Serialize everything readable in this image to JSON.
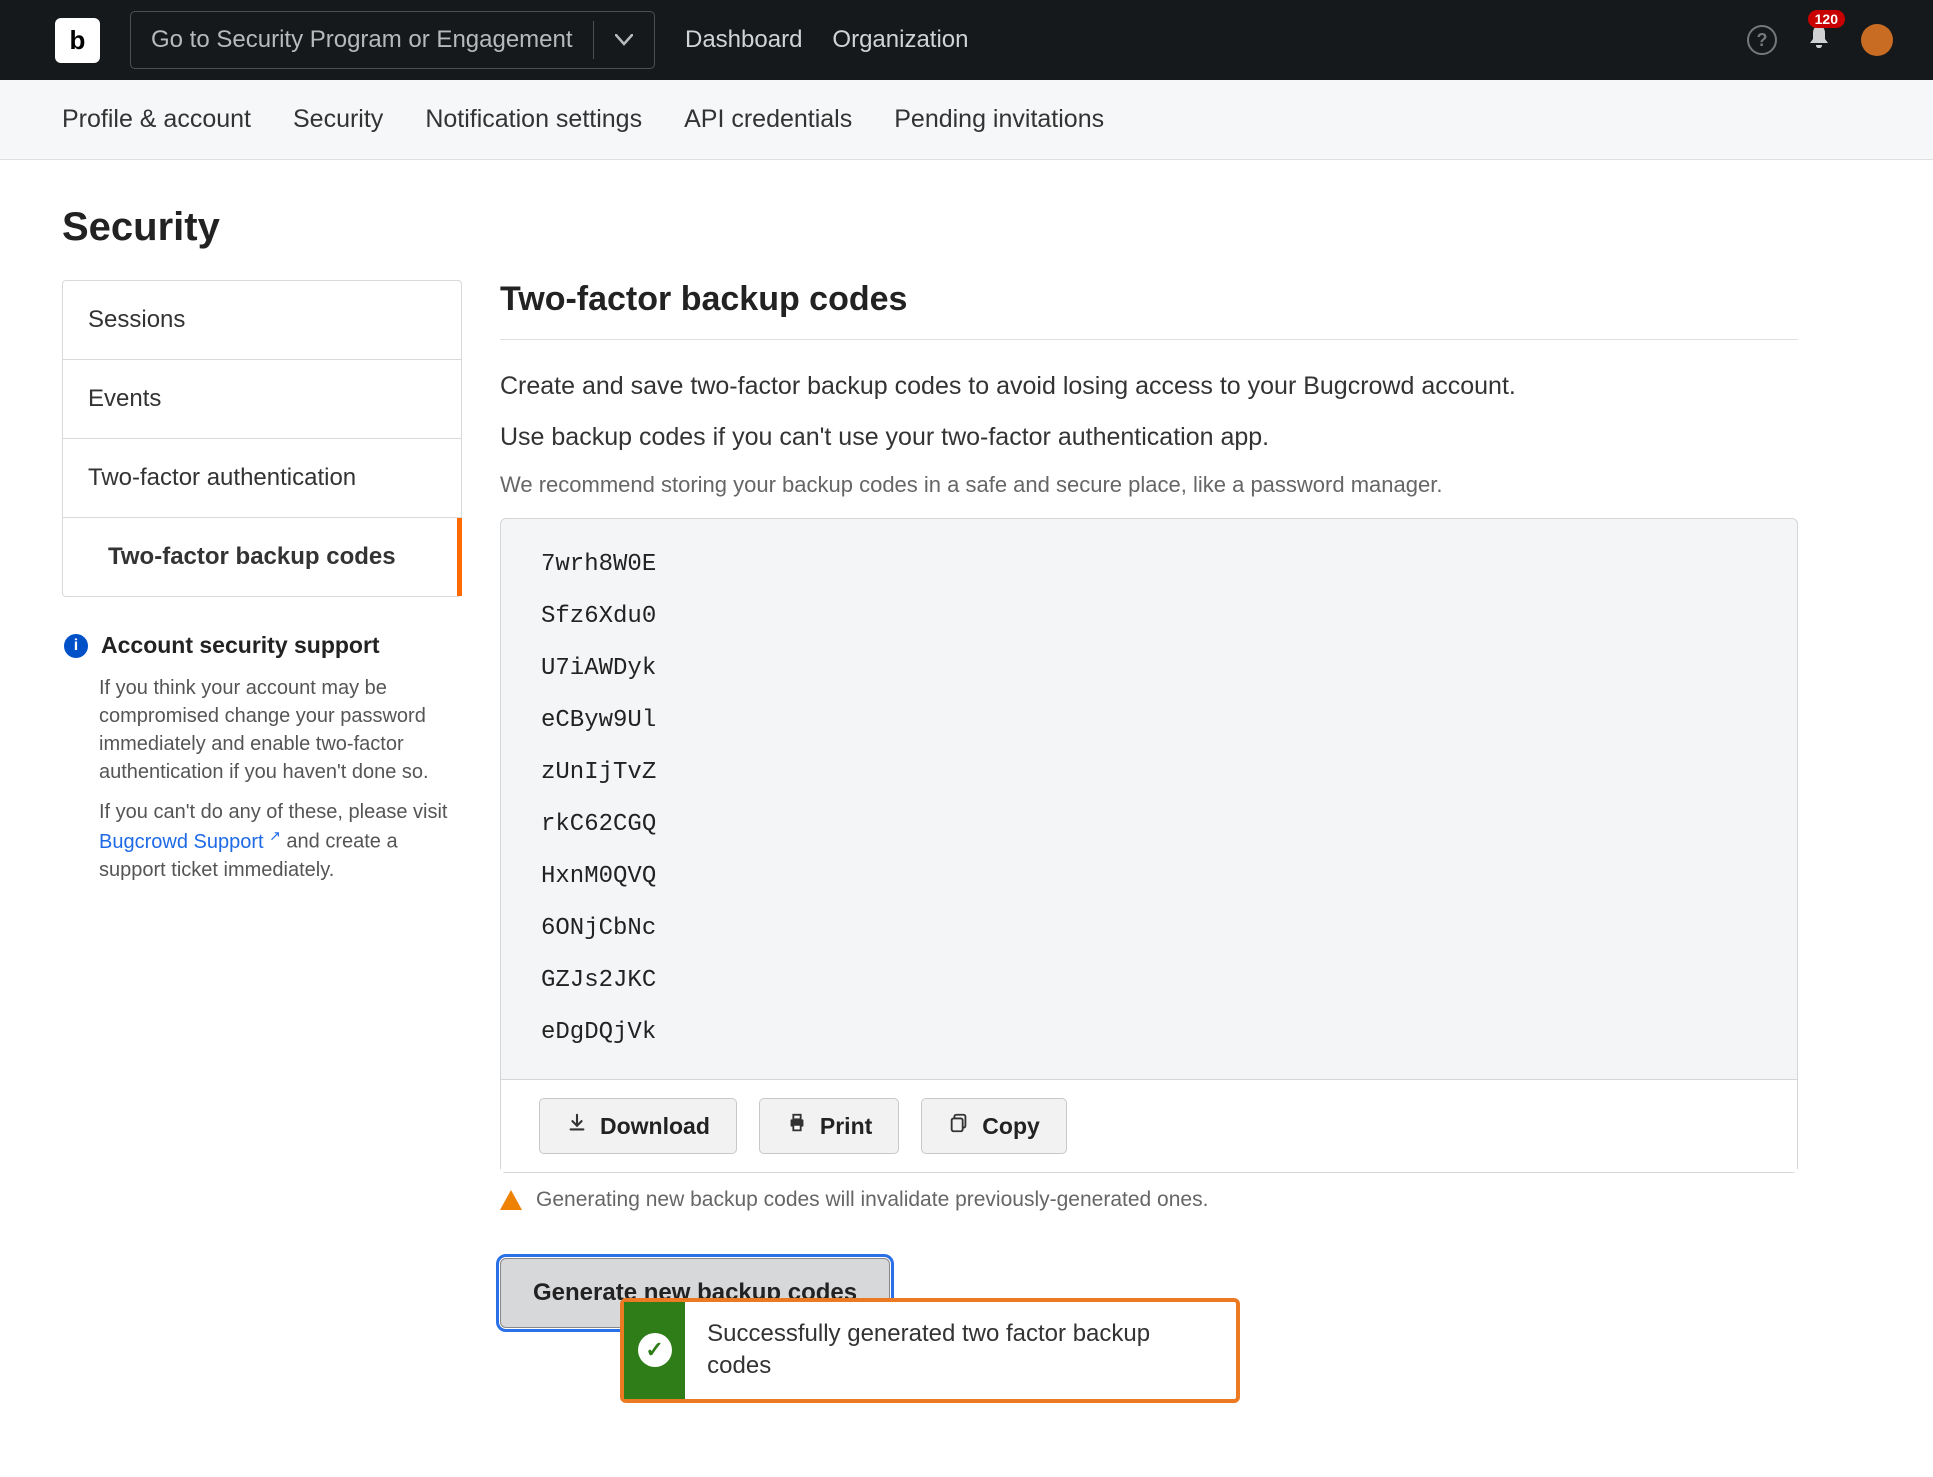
{
  "topnav": {
    "logo_letter": "b",
    "program_selector_placeholder": "Go to Security Program or Engagement",
    "links": {
      "dashboard": "Dashboard",
      "organization": "Organization"
    },
    "help_glyph": "?",
    "notifications_count": "120"
  },
  "subnav": {
    "tabs": {
      "profile": "Profile & account",
      "security": "Security",
      "notifications": "Notification settings",
      "api": "API credentials",
      "pending": "Pending invitations"
    }
  },
  "page": {
    "title": "Security"
  },
  "sidebar": {
    "items": {
      "sessions": "Sessions",
      "events": "Events",
      "twofactor": "Two-factor authentication",
      "backup": "Two-factor backup codes"
    },
    "support": {
      "info_glyph": "i",
      "title": "Account security support",
      "p1": "If you think your account may be compromised change your password immediately and enable two-factor authentication if you haven't done so.",
      "p2a": "If you can't do any of these, please visit ",
      "link": "Bugcrowd Support",
      "p2b": " and create a support ticket immediately."
    }
  },
  "main": {
    "title": "Two-factor backup codes",
    "p1": "Create and save two-factor backup codes to avoid losing access to your Bugcrowd account.",
    "p2": "Use backup codes if you can't use your two-factor authentication app.",
    "note": "We recommend storing your backup codes in a safe and secure place, like a password manager.",
    "codes": [
      "7wrh8W0E",
      "Sfz6Xdu0",
      "U7iAWDyk",
      "eCByw9Ul",
      "zUnIjTvZ",
      "rkC62CGQ",
      "HxnM0QVQ",
      "6ONjCbNc",
      "GZJs2JKC",
      "eDgDQjVk"
    ],
    "actions": {
      "download": "Download",
      "print": "Print",
      "copy": "Copy"
    },
    "warning": "Generating new backup codes will invalidate previously-generated ones.",
    "generate_label": "Generate new backup codes"
  },
  "toast": {
    "check_glyph": "✓",
    "message": "Successfully generated two factor backup codes"
  }
}
